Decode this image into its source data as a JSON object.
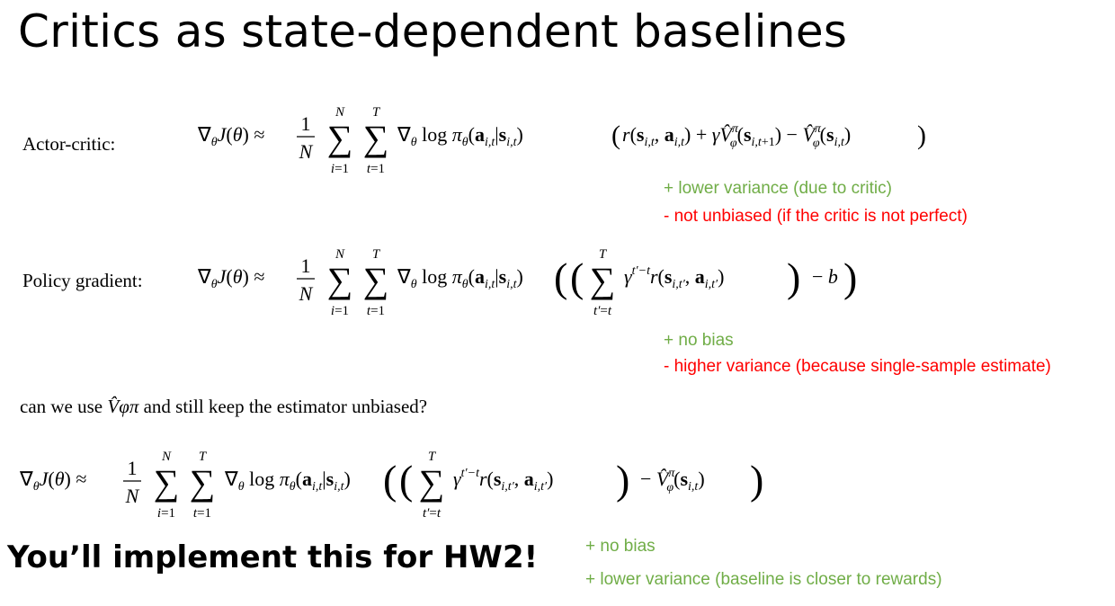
{
  "title": "Critics as state-dependent baselines",
  "rows": {
    "actor_critic": {
      "label": "Actor-critic:",
      "equation": "∇θJ(θ) ≈ (1/N) Σ_{i=1}^{N} Σ_{t=1}^{T} ∇θ log πθ(a_{i,t}|s_{i,t}) ( r(s_{i,t}, a_{i,t}) + γ V̂φπ(s_{i,t+1}) − V̂φπ(s_{i,t}) )",
      "pro": "+ lower variance (due to critic)",
      "con": "- not unbiased (if the critic is not perfect)"
    },
    "policy_gradient": {
      "label": "Policy gradient:",
      "equation": "∇θJ(θ) ≈ (1/N) Σ_{i=1}^{N} Σ_{t=1}^{T} ∇θ log πθ(a_{i,t}|s_{i,t}) ( ( Σ_{t'=t}^{T} γ^{t'−t} r(s_{i,t'}, a_{i,t'}) ) − b )",
      "pro": "+ no bias",
      "con": "- higher variance (because single-sample estimate)"
    }
  },
  "question": {
    "prefix": "can we use",
    "symbol": "V̂φπ",
    "suffix": "and still keep the estimator unbiased?"
  },
  "final": {
    "equation": "∇θJ(θ) ≈ (1/N) Σ_{i=1}^{N} Σ_{t=1}^{T} ∇θ log πθ(a_{i,t}|s_{i,t}) ( ( Σ_{t'=t}^{T} γ^{t'−t} r(s_{i,t'}, a_{i,t'}) ) − V̂φπ(s_{i,t}) )",
    "pro1": "+ no bias",
    "pro2": "+ lower variance (baseline is closer to rewards)",
    "callout": "You’ll implement this for HW2!"
  },
  "colors": {
    "positive": "#70ad47",
    "negative": "#ff0000",
    "text": "#000000"
  }
}
